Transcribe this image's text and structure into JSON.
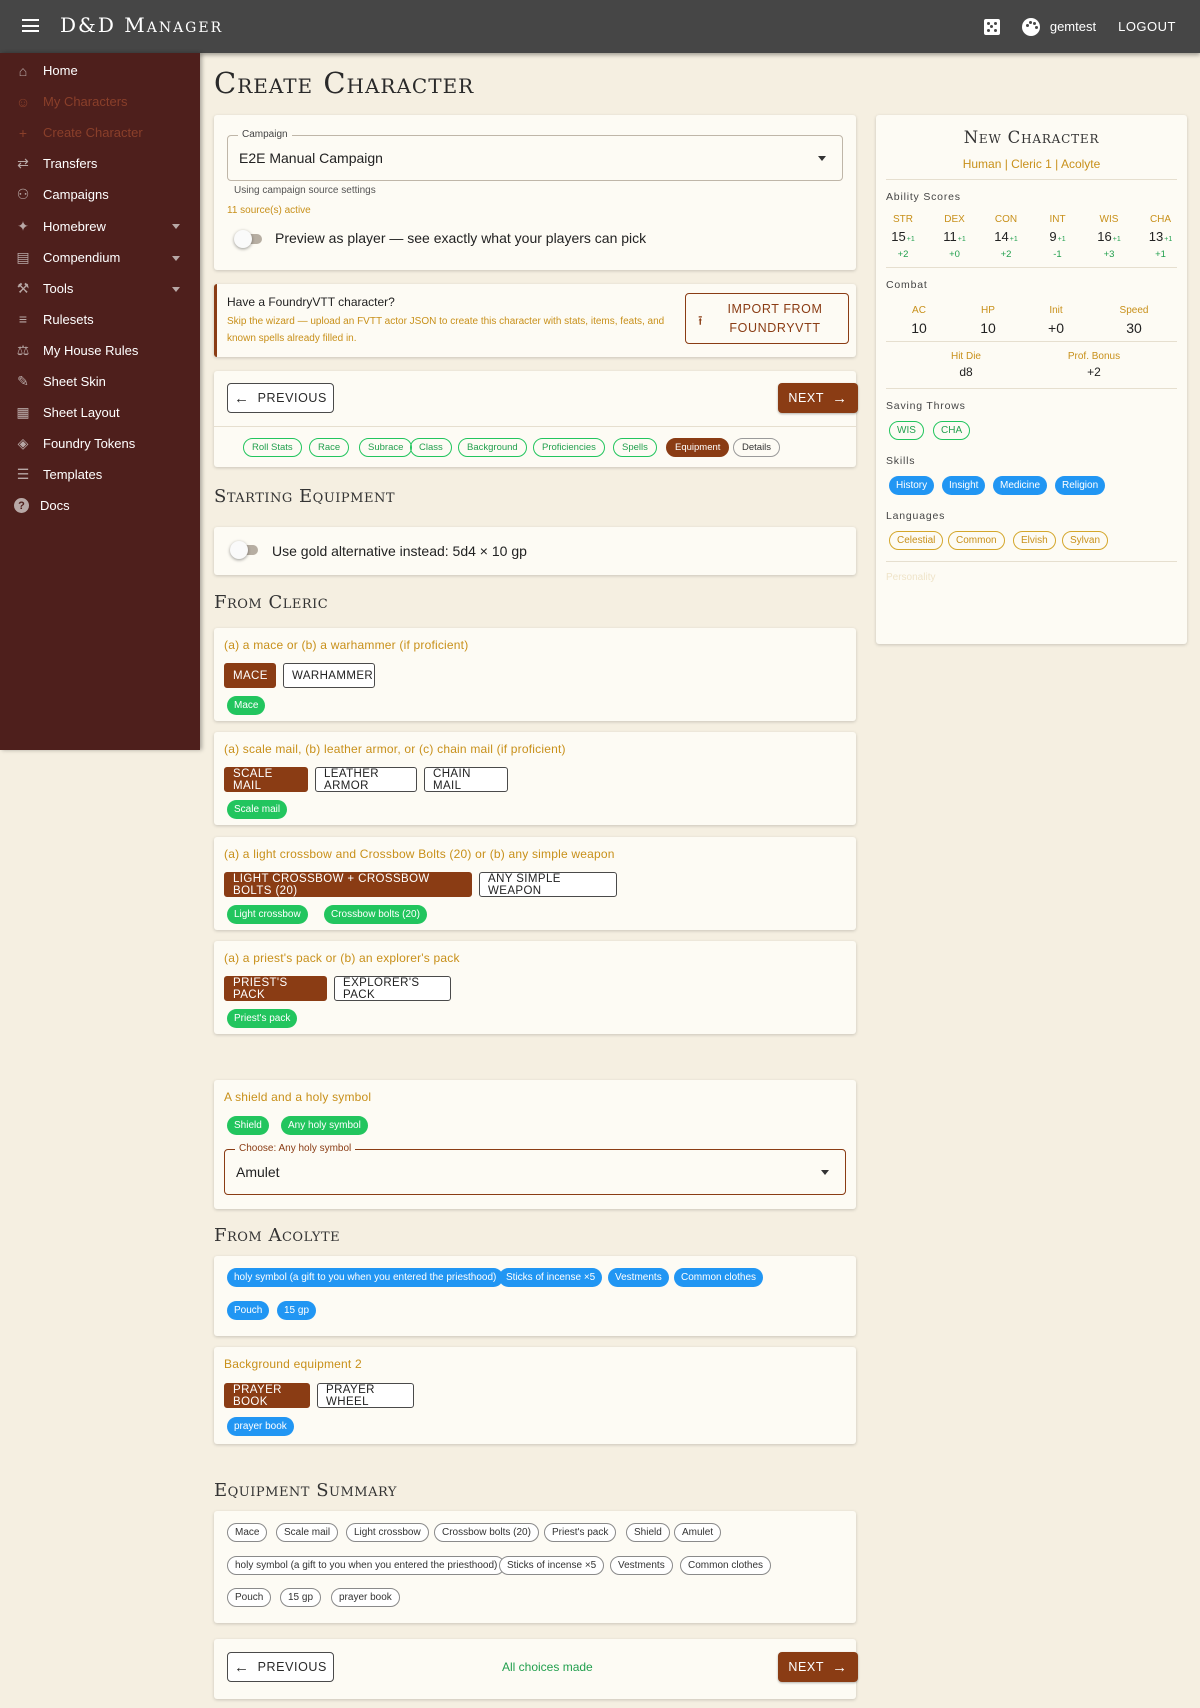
{
  "app": {
    "title": "D&D Manager",
    "username": "gemtest",
    "logout": "LOGOUT"
  },
  "sidebar": {
    "items": [
      {
        "label": "Home",
        "icon": "home-icon",
        "state": "normal",
        "caret": false
      },
      {
        "label": "My Characters",
        "icon": "people-icon",
        "state": "dim",
        "caret": false
      },
      {
        "label": "Create Character",
        "icon": "plus-icon",
        "state": "dim",
        "caret": false
      },
      {
        "label": "Transfers",
        "icon": "swap-icon",
        "state": "normal",
        "caret": false
      },
      {
        "label": "Campaigns",
        "icon": "groups-icon",
        "state": "normal",
        "caret": false
      },
      {
        "label": "Homebrew",
        "icon": "wand-icon",
        "state": "normal",
        "caret": true
      },
      {
        "label": "Compendium",
        "icon": "book-icon",
        "state": "normal",
        "caret": true
      },
      {
        "label": "Tools",
        "icon": "wrench-icon",
        "state": "normal",
        "caret": true
      },
      {
        "label": "Rulesets",
        "icon": "rule-icon",
        "state": "normal",
        "caret": false
      },
      {
        "label": "My House Rules",
        "icon": "gavel-icon",
        "state": "normal",
        "caret": false
      },
      {
        "label": "Sheet Skin",
        "icon": "brush-icon",
        "state": "normal",
        "caret": false
      },
      {
        "label": "Sheet Layout",
        "icon": "grid-icon",
        "state": "normal",
        "caret": false
      },
      {
        "label": "Foundry Tokens",
        "icon": "cube-icon",
        "state": "normal",
        "caret": false
      },
      {
        "label": "Templates",
        "icon": "document-icon",
        "state": "normal",
        "caret": false
      },
      {
        "label": "Docs",
        "icon": "help-icon",
        "state": "normal",
        "caret": false
      }
    ]
  },
  "page": {
    "title": "Create Character"
  },
  "campaign": {
    "label": "Campaign",
    "value": "E2E Manual Campaign",
    "helper": "Using campaign source settings",
    "sources": "11 source(s) active",
    "preview_label": "Preview as player — see exactly what your players can pick"
  },
  "foundry": {
    "title": "Have a FoundryVTT character?",
    "desc": "Skip the wizard — upload an FVTT actor JSON to create this character with stats, items, feats, and known spells already filled in.",
    "button_line1": "IMPORT FROM",
    "button_line2": "FOUNDRYVTT"
  },
  "nav": {
    "previous": "PREVIOUS",
    "next": "NEXT",
    "status": "All choices made"
  },
  "steps": [
    "Roll Stats",
    "Race",
    "Subrace",
    "Class",
    "Background",
    "Proficiencies",
    "Spells",
    "Equipment",
    "Details"
  ],
  "active_step": "Equipment",
  "starting_equipment": {
    "title": "Starting Equipment",
    "gold_label": "Use gold alternative instead: 5d4 × 10 gp",
    "from_class_title": "From Cleric",
    "class_choices": [
      {
        "question": "(a) a mace or (b) a warhammer (if proficient)",
        "options": [
          "MACE",
          "WARHAMMER"
        ],
        "selected": 0,
        "items": [
          "Mace"
        ]
      },
      {
        "question": "(a) scale mail, (b) leather armor, or (c) chain mail (if proficient)",
        "options": [
          "SCALE MAIL",
          "LEATHER ARMOR",
          "CHAIN MAIL"
        ],
        "selected": 0,
        "items": [
          "Scale mail"
        ]
      },
      {
        "question": "(a) a light crossbow and Crossbow Bolts (20) or (b) any simple weapon",
        "options": [
          "LIGHT CROSSBOW + CROSSBOW BOLTS (20)",
          "ANY SIMPLE WEAPON"
        ],
        "selected": 0,
        "items": [
          "Light crossbow",
          "Crossbow bolts (20)"
        ]
      },
      {
        "question": "(a) a priest's pack or (b) an explorer's pack",
        "options": [
          "PRIEST'S PACK",
          "EXPLORER'S PACK"
        ],
        "selected": 0,
        "items": [
          "Priest's pack"
        ]
      }
    ],
    "shield": {
      "question": "A shield and a holy symbol",
      "items": [
        "Shield",
        "Any holy symbol"
      ],
      "choose_label": "Choose: Any holy symbol",
      "choose_value": "Amulet"
    },
    "from_bg_title": "From Acolyte",
    "bg_items": [
      "holy symbol (a gift to you when you entered the priesthood)",
      "Sticks of incense ×5",
      "Vestments",
      "Common clothes",
      "Pouch",
      "15 gp"
    ],
    "bg_choice": {
      "question": "Background equipment 2",
      "options": [
        "PRAYER BOOK",
        "PRAYER WHEEL"
      ],
      "selected": 0,
      "items": [
        "prayer book"
      ]
    }
  },
  "summary": {
    "title": "Equipment Summary",
    "items": [
      "Mace",
      "Scale mail",
      "Light crossbow",
      "Crossbow bolts (20)",
      "Priest's pack",
      "Shield",
      "Amulet",
      "holy symbol (a gift to you when you entered the priesthood)",
      "Sticks of incense ×5",
      "Vestments",
      "Common clothes",
      "Pouch",
      "15 gp",
      "prayer book"
    ]
  },
  "panel": {
    "title": "New Character",
    "subtitle": "Human | Cleric 1 | Acolyte",
    "ability_header": "Ability Scores",
    "abilities": [
      {
        "name": "STR",
        "score": "15",
        "bonus": "+1",
        "mod": "+2"
      },
      {
        "name": "DEX",
        "score": "11",
        "bonus": "+1",
        "mod": "+0"
      },
      {
        "name": "CON",
        "score": "14",
        "bonus": "+1",
        "mod": "+2"
      },
      {
        "name": "INT",
        "score": "9",
        "bonus": "+1",
        "mod": "-1"
      },
      {
        "name": "WIS",
        "score": "16",
        "bonus": "+1",
        "mod": "+3"
      },
      {
        "name": "CHA",
        "score": "13",
        "bonus": "+1",
        "mod": "+1"
      }
    ],
    "combat_header": "Combat",
    "combat": [
      {
        "name": "AC",
        "value": "10"
      },
      {
        "name": "HP",
        "value": "10"
      },
      {
        "name": "Init",
        "value": "+0"
      },
      {
        "name": "Speed",
        "value": "30"
      }
    ],
    "hit_die_label": "Hit Die",
    "hit_die": "d8",
    "prof_label": "Prof. Bonus",
    "prof": "+2",
    "saves_header": "Saving Throws",
    "saves": [
      "WIS",
      "CHA"
    ],
    "skills_header": "Skills",
    "skills": [
      "History",
      "Insight",
      "Medicine",
      "Religion"
    ],
    "languages_header": "Languages",
    "languages": [
      "Celestial",
      "Common",
      "Elvish",
      "Sylvan"
    ],
    "personality": "Personality"
  },
  "colors": {
    "sidebar": "#4e1f1c",
    "topbar": "#464646",
    "accent": "#8a3c14",
    "gold": "#c8901a",
    "green": "#22c55e",
    "blue": "#2196f3",
    "bg": "#f5efe1"
  }
}
